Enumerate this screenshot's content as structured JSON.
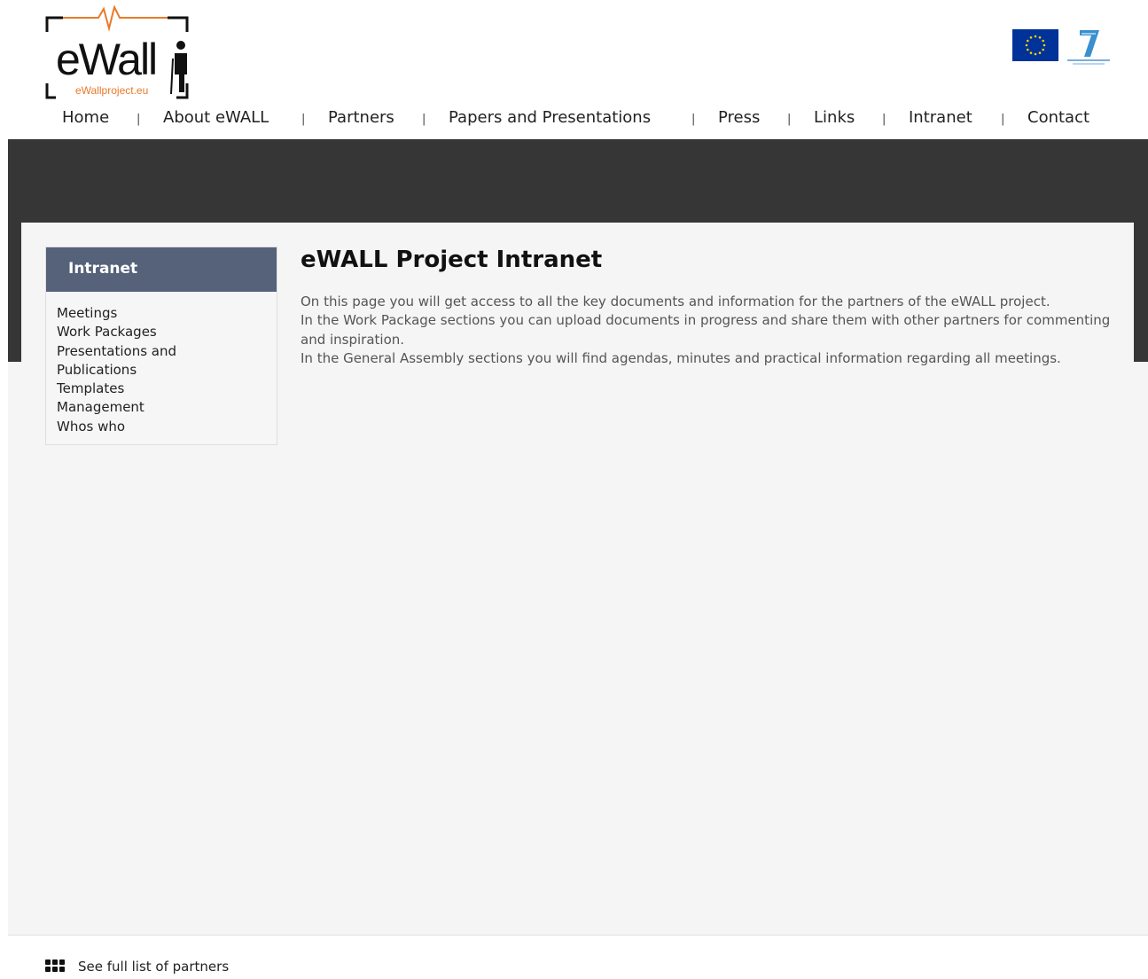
{
  "header": {
    "logo_text": "eWall",
    "logo_url_text": "eWallproject.eu"
  },
  "nav": {
    "items": [
      "Home",
      "About eWALL",
      "Partners",
      "Papers and Presentations",
      "Press",
      "Links",
      "Intranet",
      "Contact"
    ],
    "separator": "|"
  },
  "sidebar": {
    "title": "Intranet",
    "items": [
      "Meetings",
      "Work Packages",
      "Presentations and Publications",
      "Templates",
      "Management",
      "Whos who"
    ]
  },
  "main": {
    "title": "eWALL Project Intranet",
    "paragraphs": [
      "On this page you will get access to all the key documents and information for the partners of the eWALL project.",
      "In the Work Package sections you can upload documents in progress and share them with other partners for commenting and inspiration.",
      "In the General Assembly sections you will find agendas, minutes and practical information regarding all meetings."
    ]
  },
  "footer": {
    "partners_link": "See full list of partners"
  },
  "colors": {
    "banner": "#363636",
    "sidebar_header": "#56627a",
    "panel_bg": "#f5f5f5",
    "logo_orange": "#e87a2a",
    "eu_blue": "#003399"
  },
  "icons": [
    "ewall-logo",
    "eu-flag-icon",
    "fp7-logo-icon",
    "grid-icon"
  ]
}
